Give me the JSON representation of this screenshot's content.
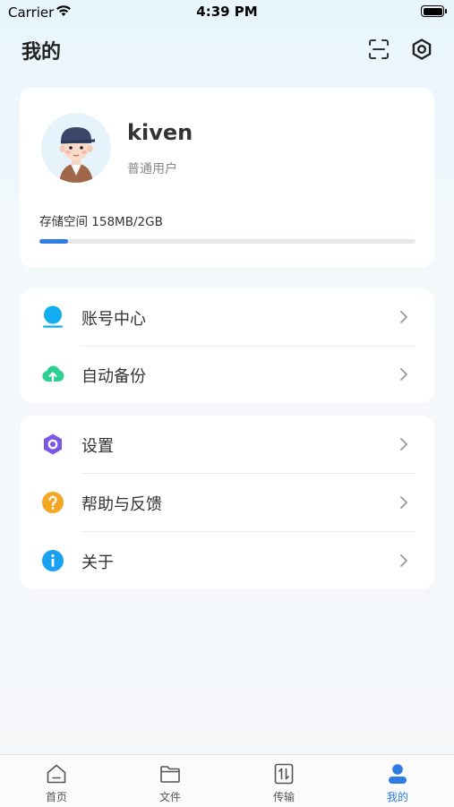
{
  "status_bar": {
    "carrier": "Carrier",
    "time": "4:39 PM"
  },
  "header": {
    "title": "我的",
    "scan_icon": "scan-icon",
    "settings_icon": "settings-icon"
  },
  "profile": {
    "username": "kiven",
    "role": "普通用户",
    "storage_label": "存储空间 158MB/2GB",
    "storage_used_fraction": 0.077
  },
  "menu_group_1": [
    {
      "label": "账号中心",
      "icon": "account-icon",
      "color": "#13aef2"
    },
    {
      "label": "自动备份",
      "icon": "cloud-upload-icon",
      "color": "#2ecf93"
    }
  ],
  "menu_group_2": [
    {
      "label": "设置",
      "icon": "settings-icon",
      "color": "#7a56e6"
    },
    {
      "label": "帮助与反馈",
      "icon": "help-icon",
      "color": "#f5a623"
    },
    {
      "label": "关于",
      "icon": "info-icon",
      "color": "#1aa1f0"
    }
  ],
  "tabbar": {
    "tabs": [
      {
        "label": "首页",
        "icon": "home-icon"
      },
      {
        "label": "文件",
        "icon": "folder-icon"
      },
      {
        "label": "传输",
        "icon": "transfer-icon"
      },
      {
        "label": "我的",
        "icon": "user-icon"
      }
    ],
    "active_index": 3
  },
  "colors": {
    "accent": "#2f7de1",
    "background": "#f5f7f9"
  }
}
